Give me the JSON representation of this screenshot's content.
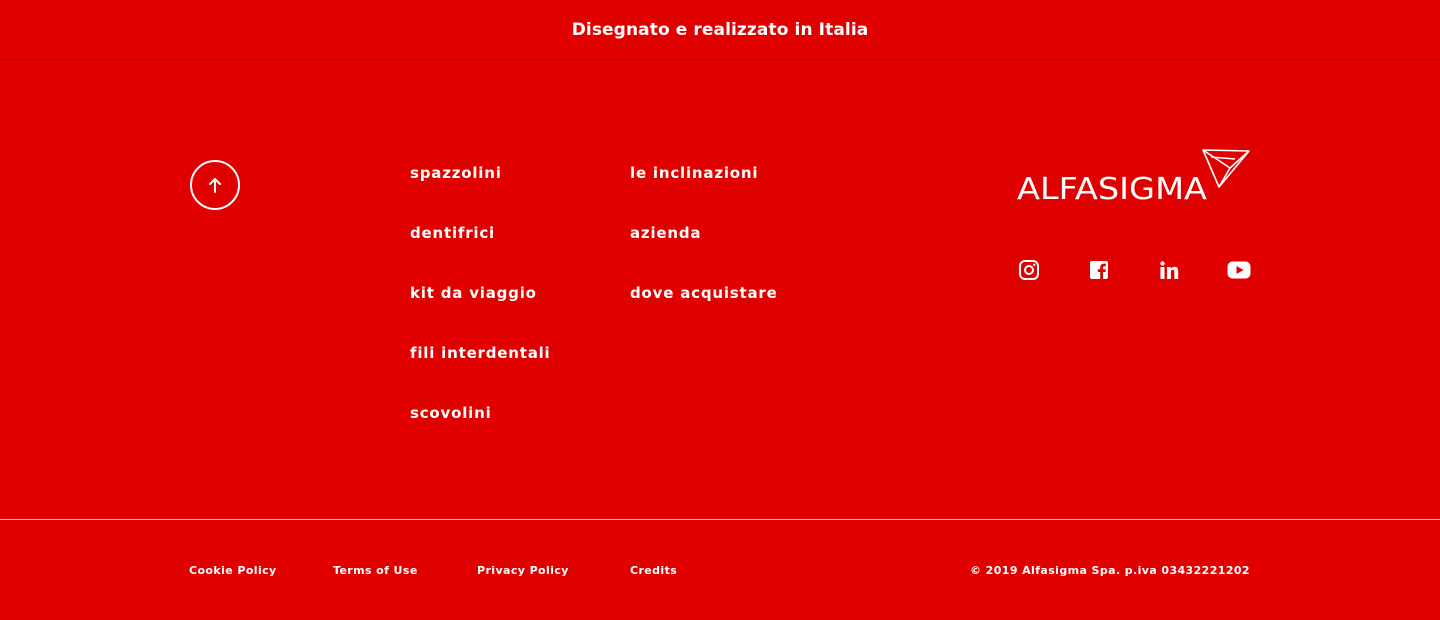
{
  "tagline": "Disegnato e realizzato in Italia",
  "back_to_top": {
    "icon": "arrow-up-icon"
  },
  "nav": {
    "col1": [
      {
        "label": "spazzolini"
      },
      {
        "label": "dentifrici"
      },
      {
        "label": "kit da viaggio"
      },
      {
        "label": "fili interdentali"
      },
      {
        "label": "scovolini"
      }
    ],
    "col2": [
      {
        "label": "le inclinazioni"
      },
      {
        "label": "azienda"
      },
      {
        "label": "dove acquistare"
      }
    ]
  },
  "brand": {
    "logo_text": "ALFASIGMA"
  },
  "social": [
    {
      "icon": "instagram-icon"
    },
    {
      "icon": "facebook-icon"
    },
    {
      "icon": "linkedin-icon"
    },
    {
      "icon": "youtube-icon"
    }
  ],
  "legal": {
    "links": [
      {
        "label": "Cookie Policy"
      },
      {
        "label": "Terms of Use"
      },
      {
        "label": "Privacy Policy"
      },
      {
        "label": "Credits"
      }
    ],
    "copyright": "© 2019 Alfasigma Spa. p.iva 03432221202"
  },
  "colors": {
    "background": "#e10000",
    "foreground": "#ffffff"
  }
}
